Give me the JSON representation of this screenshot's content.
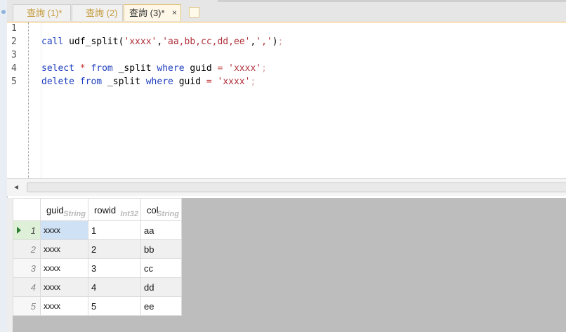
{
  "tabs": [
    {
      "label": "查詢 (1)*",
      "active": false
    },
    {
      "label": "查詢 (2)",
      "active": false
    },
    {
      "label": "查詢 (3)*",
      "active": true,
      "close": "×"
    }
  ],
  "editor": {
    "line_numbers": [
      "1",
      "2",
      "3",
      "4",
      "5"
    ],
    "line2": {
      "kw_call": "call",
      "fn": " udf_split(",
      "s1": "'xxxx'",
      "c1": ",",
      "s2": "'aa,bb,cc,dd,ee'",
      "c2": ",",
      "s3": "','",
      "end": ")",
      "semi": ";"
    },
    "line4": {
      "kw1": "select",
      "star": " * ",
      "kw2": "from",
      "t": " _split ",
      "kw3": "where",
      "f": " guid ",
      "eq": "=",
      "sp": " ",
      "s": "'xxxx'",
      "semi": ";"
    },
    "line5": {
      "kw1": "delete",
      "sp": " ",
      "kw2": "from",
      "t": " _split ",
      "kw3": "where",
      "f": " guid ",
      "eq": "=",
      "sp2": " ",
      "s": "'xxxx'",
      "semi": ";"
    }
  },
  "scroll": {
    "left_arrow": "◂"
  },
  "grid": {
    "columns": [
      {
        "name": "guid",
        "type": "String"
      },
      {
        "name": "rowid",
        "type": "Int32"
      },
      {
        "name": "col",
        "type": "String"
      }
    ],
    "rows": [
      {
        "num": "1",
        "guid": "xxxx",
        "rowid": "1",
        "col": "aa"
      },
      {
        "num": "2",
        "guid": "xxxx",
        "rowid": "2",
        "col": "bb"
      },
      {
        "num": "3",
        "guid": "xxxx",
        "rowid": "3",
        "col": "cc"
      },
      {
        "num": "4",
        "guid": "xxxx",
        "rowid": "4",
        "col": "dd"
      },
      {
        "num": "5",
        "guid": "xxxx",
        "rowid": "5",
        "col": "ee"
      }
    ]
  }
}
